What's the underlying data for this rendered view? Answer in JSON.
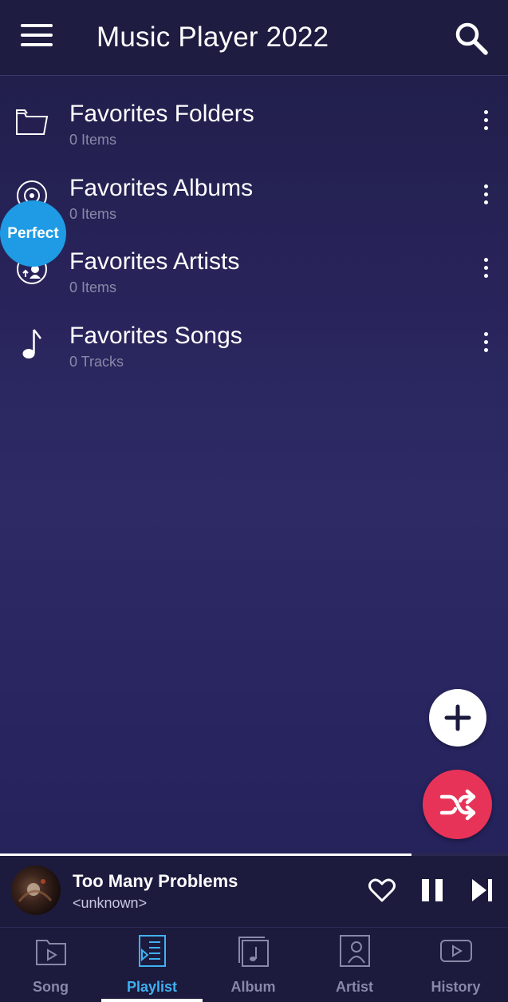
{
  "header": {
    "title": "Music Player 2022",
    "menu_icon": "hamburger-menu-icon",
    "search_icon": "search-icon"
  },
  "favorites": [
    {
      "title": "Favorites Folders",
      "subtitle": "0 Items",
      "icon": "folder-icon"
    },
    {
      "title": "Favorites Albums",
      "subtitle": "0 Items",
      "icon": "disc-icon"
    },
    {
      "title": "Favorites Artists",
      "subtitle": "0 Items",
      "icon": "artist-icon"
    },
    {
      "title": "Favorites Songs",
      "subtitle": "0 Tracks",
      "icon": "music-note-icon"
    }
  ],
  "overlay_bubble": {
    "label": "Perfect"
  },
  "fabs": {
    "add_icon": "plus-icon",
    "shuffle_icon": "shuffle-icon",
    "shuffle_color": "#e83358"
  },
  "now_playing": {
    "title": "Too Many Problems",
    "artist": "<unknown>",
    "progress": 0.81
  },
  "bottom_nav": {
    "tabs": [
      {
        "label": "Song",
        "icon": "song-icon",
        "active": false
      },
      {
        "label": "Playlist",
        "icon": "playlist-icon",
        "active": true
      },
      {
        "label": "Album",
        "icon": "album-icon",
        "active": false
      },
      {
        "label": "Artist",
        "icon": "artist-icon",
        "active": false
      },
      {
        "label": "History",
        "icon": "history-icon",
        "active": false
      }
    ],
    "active_color": "#3fb1f0"
  }
}
